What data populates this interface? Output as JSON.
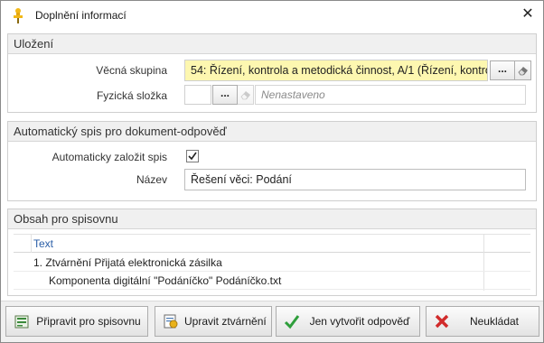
{
  "window": {
    "title": "Doplnění informací"
  },
  "section_ulozeni": {
    "header": "Uložení",
    "vecna_skupina_label": "Věcná skupina",
    "vecna_skupina_value": "54: Řízení, kontrola a metodická činnost, A/1 (Řízení, kontrola",
    "browse_label": "...",
    "fyzicka_slozka_label": "Fyzická složka",
    "fyzicka_slozka_placeholder": "Nenastaveno"
  },
  "section_spis": {
    "header": "Automatický spis pro dokument-odpověď",
    "auto_label": "Automaticky založit spis",
    "auto_checked": true,
    "checkmark": "✓",
    "nazev_label": "Název",
    "nazev_value": "Řešení věci:  Podání"
  },
  "section_obsah": {
    "header": "Obsah pro spisovnu",
    "column_header": "Text",
    "rows": [
      "1. Ztvárnění Přijatá elektronická zásilka",
      "Komponenta digitální \"Podáníčko\" Podáníčko.txt"
    ]
  },
  "footer": {
    "btn_pripravit": "Připravit pro spisovnu",
    "btn_upravit": "Upravit ztvárnění",
    "btn_vytvorit": "Jen vytvořit odpověď",
    "btn_neukladat": "Neukládat"
  },
  "icons": {
    "app": "pin-icon",
    "close": "close-icon",
    "eraser": "eraser-icon",
    "archive": "archive-icon",
    "edit_doc": "edit-document-icon",
    "ok": "checkmark-icon",
    "cancel": "cancel-icon"
  },
  "colors": {
    "highlight_field": "#fdf7b0",
    "header_link": "#2a5ea7",
    "ok_green": "#2e9e3b",
    "cancel_red": "#d12b2b"
  }
}
